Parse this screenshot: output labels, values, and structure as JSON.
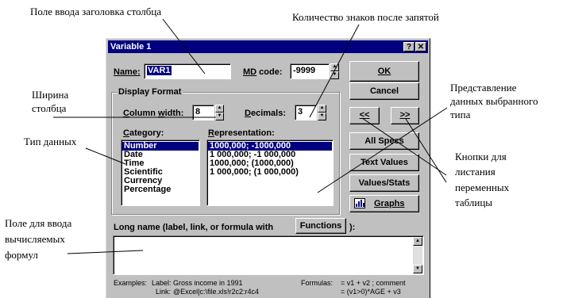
{
  "annotations": {
    "title_field": "Поле ввода заголовка столбца",
    "decimals": "Количество знаков после запятой",
    "width_line1": "Ширина",
    "width_line2": "столбца",
    "type": "Тип данных",
    "repr_line1": "Представление",
    "repr_line2": "данных выбранного",
    "repr_line3": "типа",
    "nav_line1": "Кнопки для",
    "nav_line2": "листания",
    "nav_line3": "переменных",
    "nav_line4": "таблицы",
    "formula_line1": "Поле для ввода",
    "formula_line2": "вычисляемых",
    "formula_line3": "формул"
  },
  "dialog": {
    "title": "Variable 1",
    "help_glyph": "?",
    "close_glyph": "✕",
    "name_label": "Name:",
    "name_value": "VAR1",
    "md_label": "MD code:",
    "md_value": "-9999",
    "display_format_label": "Display Format",
    "column_width_label": "Column width:",
    "column_width_value": "8",
    "decimals_label": "Decimals:",
    "decimals_value": "3",
    "category_label": "Category:",
    "representation_label": "Representation:",
    "categories": [
      "Number",
      "Date",
      "Time",
      "Scientific",
      "Currency",
      "Percentage"
    ],
    "selected_category": 0,
    "representations": [
      "1000,000; -1000,000",
      "1 000,000; -1 000,000",
      "1000,000; (1000,000)",
      "1 000,000; (1 000,000)"
    ],
    "selected_representation": 0,
    "buttons": {
      "ok": "OK",
      "cancel": "Cancel",
      "prev": "<<",
      "next": ">>",
      "all_specs": "All Specs",
      "text_values": "Text Values",
      "values_stats": "Values/Stats",
      "graphs": "Graphs",
      "functions": "Functions"
    },
    "long_name_label": "Long name (label, link, or formula with",
    "long_name_suffix": "):",
    "long_name_value": "",
    "examples": {
      "examples_label": "Examples:",
      "label_key": "Label:",
      "label_value": "Gross income in 1991",
      "link_key": "Link:",
      "link_value": "@Excel|c:\\file.xls!r2c2:r4c4",
      "formulas_key": "Formulas:",
      "formula1": "= v1 + v2 ; comment",
      "formula2": "= (v1>0)*AGE + v3"
    }
  }
}
